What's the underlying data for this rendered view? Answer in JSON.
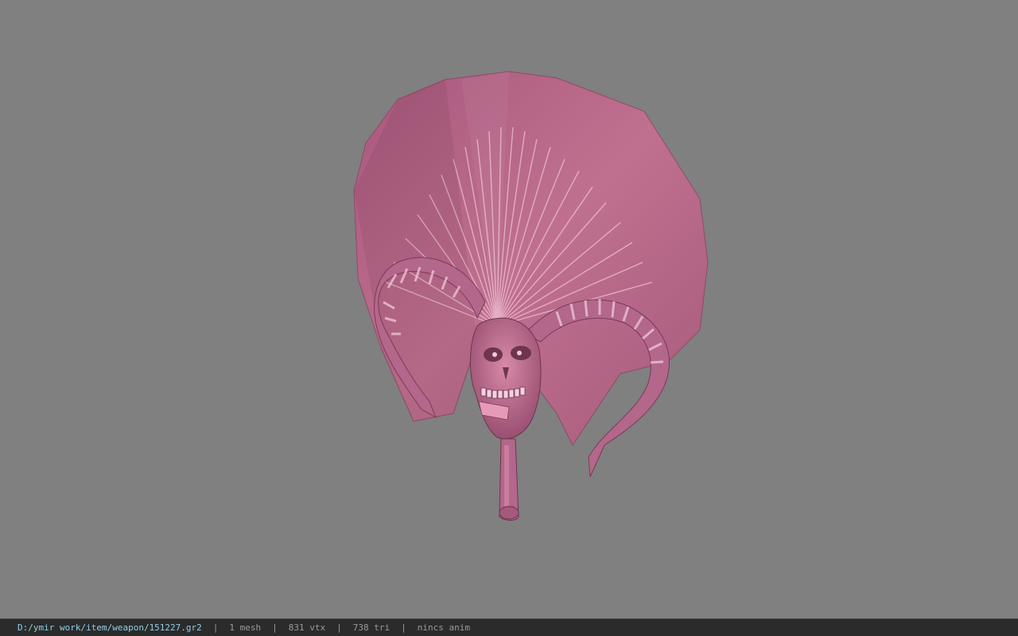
{
  "viewport": {
    "background": "#808080",
    "model": {
      "name": "demon-skull-fan-weapon",
      "base_color": "#b86a8c",
      "highlight_color": "#f2c6d6",
      "shadow_color": "#6e3550"
    }
  },
  "statusbar": {
    "file_path": "D:/ymir work/item/weapon/151227.gr2",
    "mesh_count": "1 mesh",
    "vertex_count": "831 vtx",
    "triangle_count": "738 tri",
    "animation": "nincs anim",
    "separator": "|"
  }
}
